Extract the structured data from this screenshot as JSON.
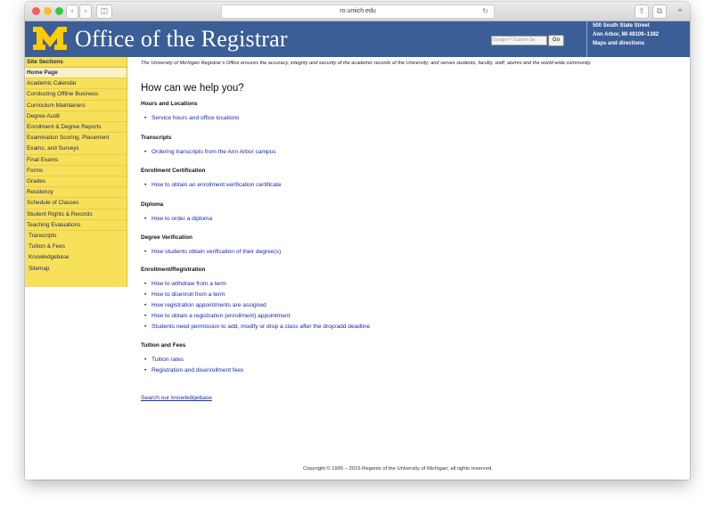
{
  "browser": {
    "url": "ro.umich.edu"
  },
  "header": {
    "title": "Office of the Registrar",
    "logo_letter": "M",
    "search_placeholder": "Google™ Custom Se",
    "search_button": "Go",
    "address": {
      "line1": "500 South State Street",
      "line2": "Ann Arbor, MI 48109–1382",
      "line3": "Maps and directions"
    }
  },
  "colors": {
    "header_bg": "#3b5e97",
    "sidebar_bg": "#f7e05a",
    "link": "#1b2aa6",
    "maize": "#ffcb05"
  },
  "sidebar": {
    "heading": "Site Sections",
    "items": [
      {
        "label": "Home Page"
      },
      {
        "label": "Academic Calendar"
      },
      {
        "label": "Conducting Offline Business"
      },
      {
        "label": "Curriculum Maintainers"
      },
      {
        "label": "Degree Audit"
      },
      {
        "label": "Enrollment & Degree Reports"
      },
      {
        "label": "Examination Scoring, Placement"
      },
      {
        "label": "Exams, and Surveys"
      },
      {
        "label": "Final Exams"
      },
      {
        "label": "Forms"
      },
      {
        "label": "Grades"
      },
      {
        "label": "Residency"
      },
      {
        "label": "Schedule of Classes"
      },
      {
        "label": "Student Rights & Records"
      },
      {
        "label": "Teaching Evaluations"
      },
      {
        "label": "Transcripts"
      },
      {
        "label": "Tuition & Fees"
      },
      {
        "label": "Knowledgebase"
      },
      {
        "label": "Sitemap"
      }
    ]
  },
  "main": {
    "intro": "The University of Michigan Registrar’s Office ensures the accuracy, integrity and security of the academic records of the University; and serves students, faculty, staff, alumni and the world-wide community.",
    "heading": "How can we help you?",
    "sections": [
      {
        "title": "Hours and Locations",
        "links": [
          "Service hours and office locations"
        ]
      },
      {
        "title": "Transcripts",
        "links": [
          "Ordering transcripts from the Ann Arbor campus"
        ]
      },
      {
        "title": "Enrollment Certification",
        "links": [
          "How to obtain an enrollment verification certificate"
        ]
      },
      {
        "title": "Diploma",
        "links": [
          "How to order a diploma"
        ]
      },
      {
        "title": "Degree Verification",
        "links": [
          "How students obtain verification of their degree(s)"
        ]
      },
      {
        "title": "Enrollment/Registration",
        "links": [
          "How to withdraw from a term",
          "How to disenroll from a term",
          "How registration appointments are assigned",
          "How to obtain a registration (enrollment) appointment",
          "Students need permission to add, modify or drop a class after the drop/add deadline"
        ]
      },
      {
        "title": "Tuition and Fees",
        "links": [
          "Tuition rates",
          "Registration and disenrollment fees"
        ]
      }
    ],
    "knowledgebase_link": "Search our knowledgebase"
  },
  "footer": {
    "copyright": "Copyright © 1995 – 2016 Regents of the University of Michigan; all rights reserved."
  }
}
